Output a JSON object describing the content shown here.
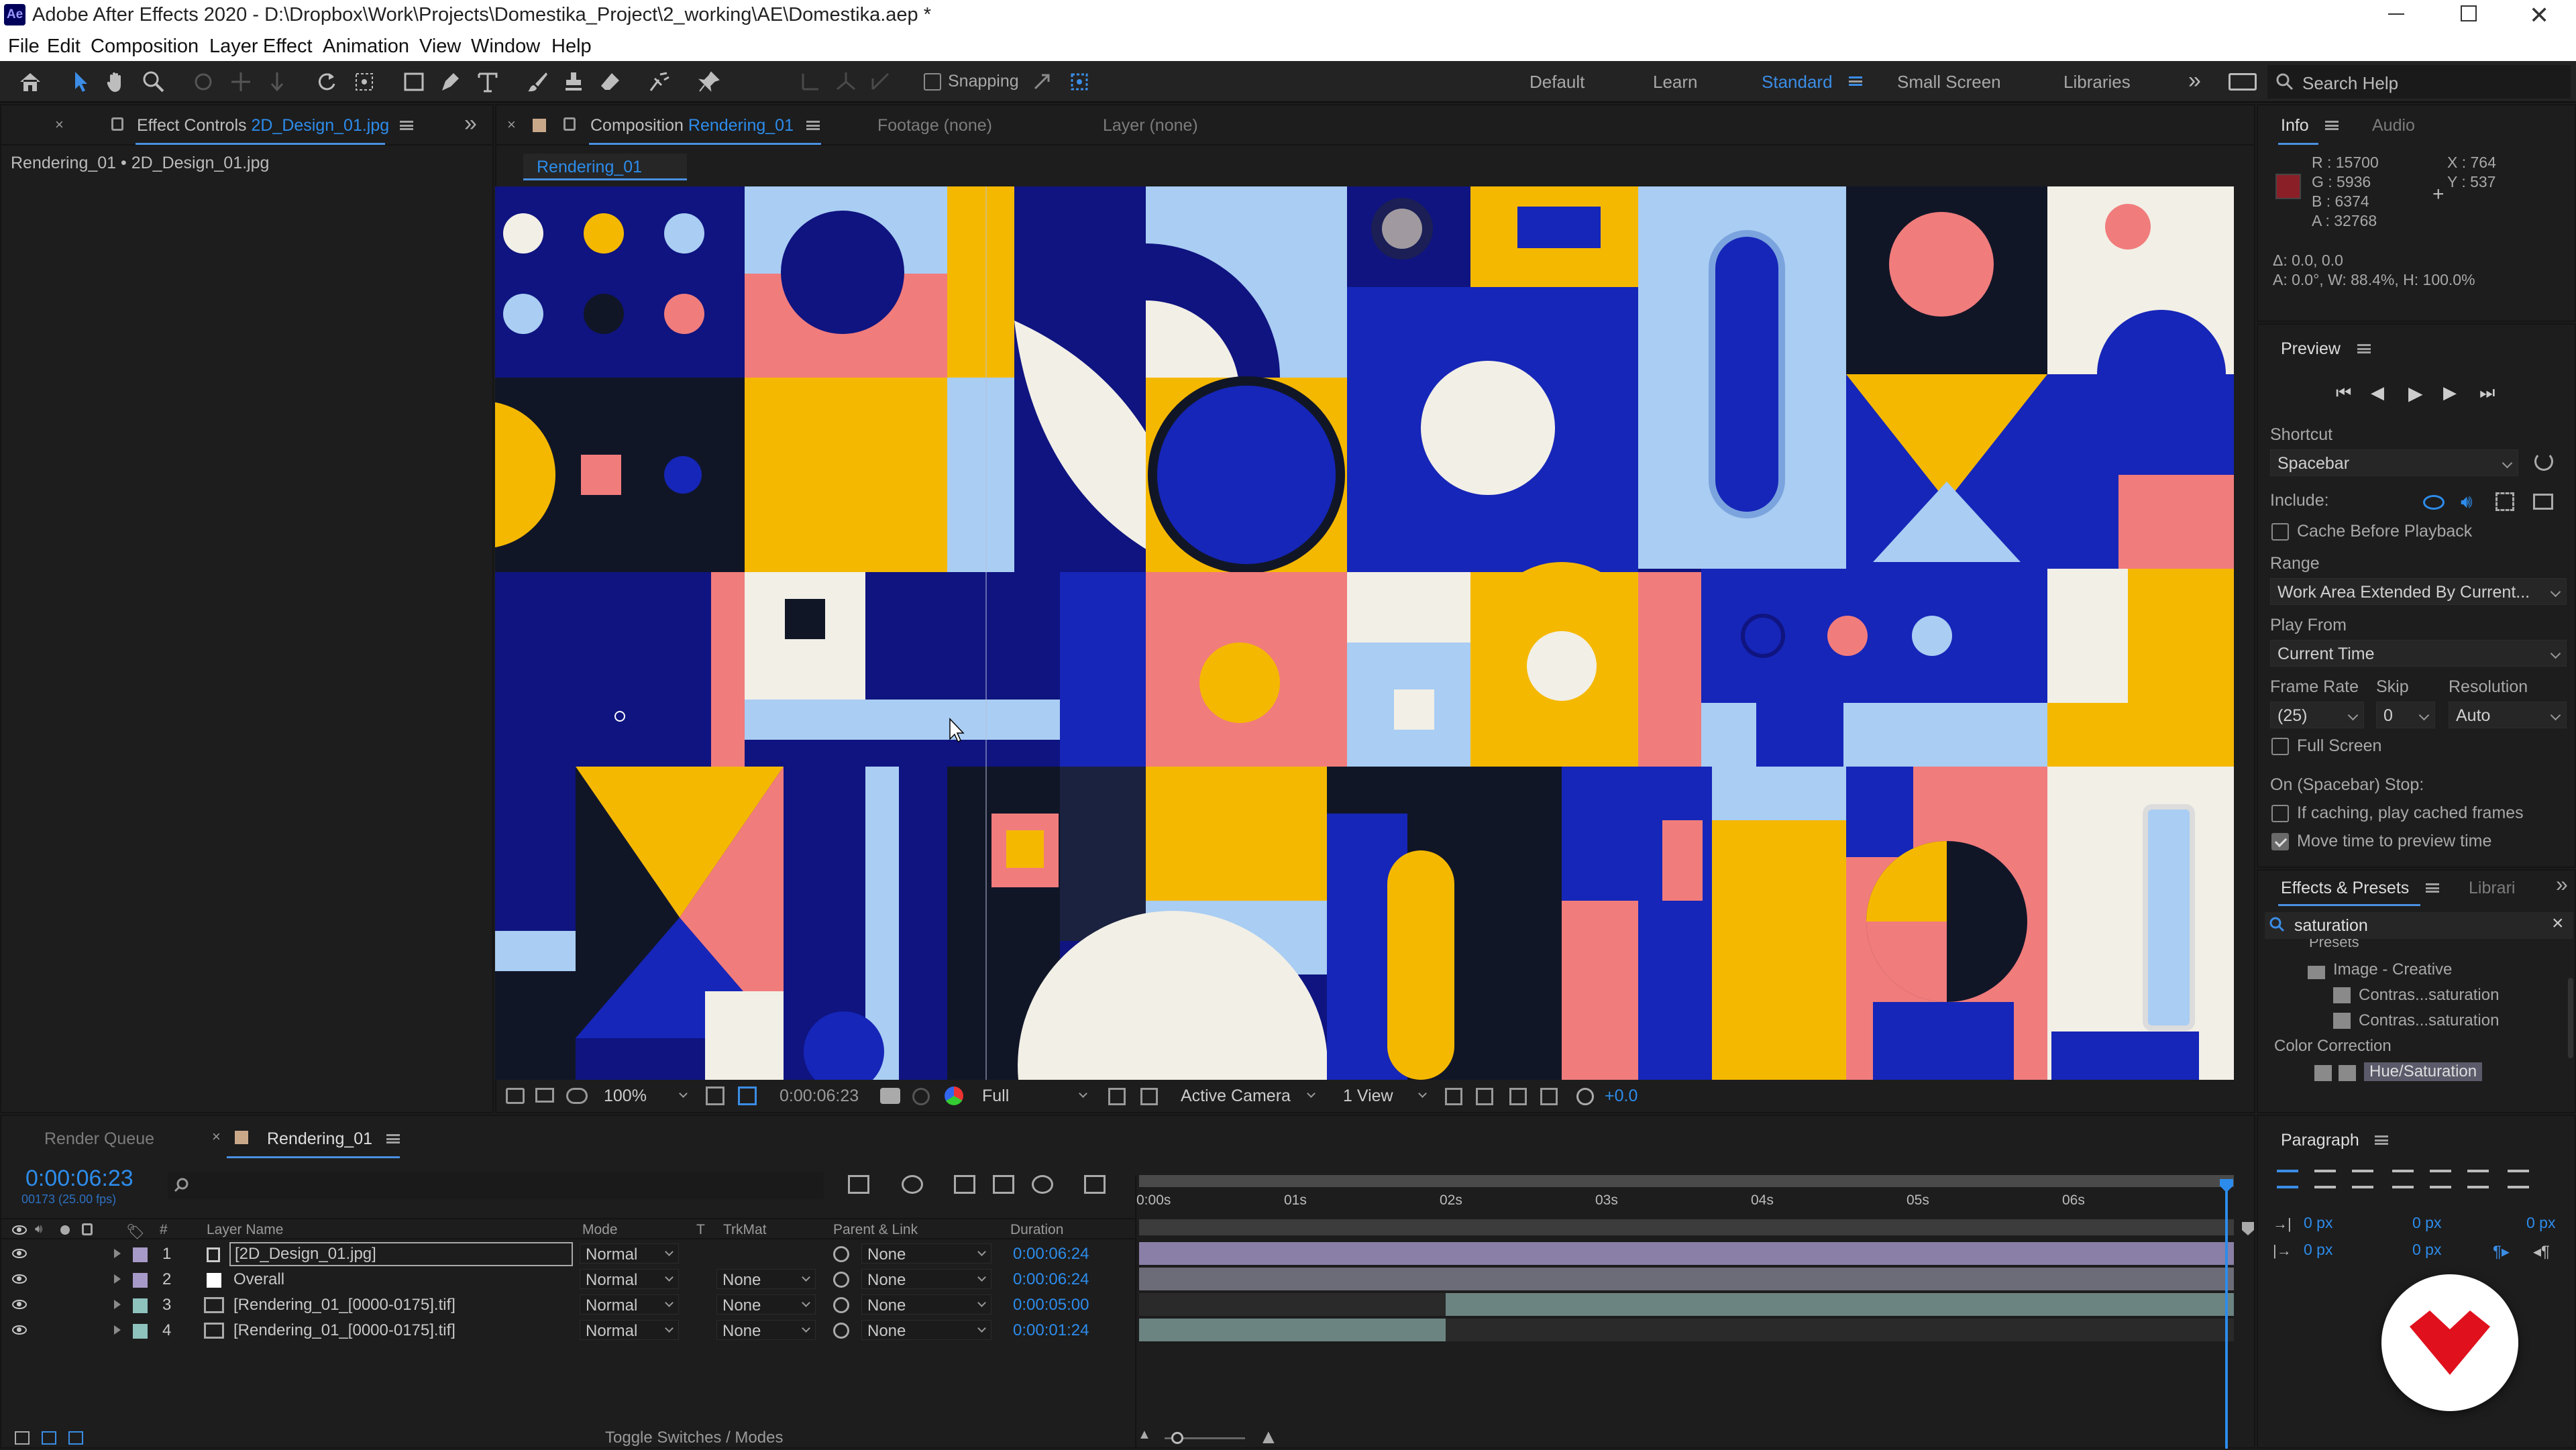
{
  "app": {
    "title": "Adobe After Effects 2020 - D:\\Dropbox\\Work\\Projects\\Domestika_Project\\2_working\\AE\\Domestika.aep *",
    "logo": "Ae"
  },
  "menu": [
    "File",
    "Edit",
    "Composition",
    "Layer",
    "Effect",
    "Animation",
    "View",
    "Window",
    "Help"
  ],
  "toolbar": {
    "snapping_label": "Snapping",
    "search_placeholder": "Search Help"
  },
  "workspaces": [
    "Default",
    "Learn",
    "Standard",
    "Small Screen",
    "Libraries"
  ],
  "workspace_active": "Standard",
  "effect_controls": {
    "tab_label": "Effect Controls",
    "tab_file": "2D_Design_01.jpg",
    "breadcrumb": "Rendering_01 • 2D_Design_01.jpg"
  },
  "composition": {
    "tab_label": "Composition",
    "tab_name": "Rendering_01",
    "footage_tab": "Footage  (none)",
    "layer_tab": "Layer  (none)",
    "sub_tab": "Rendering_01"
  },
  "viewer_footer": {
    "zoom": "100%",
    "timecode": "0:00:06:23",
    "resolution": "Full",
    "camera": "Active Camera",
    "views": "1 View",
    "exposure": "+0.0"
  },
  "info": {
    "tab_info": "Info",
    "tab_audio": "Audio",
    "r": "R : 15700",
    "g": "G : 5936",
    "b": "B : 6374",
    "a": "A : 32768",
    "x": "X : 764",
    "y": "Y : 537",
    "delta": "Δ: 0.0, 0.0",
    "transform": "A: 0.0°, W: 88.4%, H: 100.0%",
    "swatch_color": "#8a1f28"
  },
  "preview": {
    "title": "Preview",
    "shortcut_label": "Shortcut",
    "shortcut_value": "Spacebar",
    "include_label": "Include:",
    "cache_label": "Cache Before Playback",
    "range_label": "Range",
    "range_value": "Work Area Extended By Current...",
    "play_from_label": "Play From",
    "play_from_value": "Current Time",
    "frame_rate_label": "Frame Rate",
    "skip_label": "Skip",
    "resolution_label": "Resolution",
    "frame_rate_value": "(25)",
    "skip_value": "0",
    "resolution_value": "Auto",
    "full_screen_label": "Full Screen",
    "stop_label": "On (Spacebar) Stop:",
    "if_caching_label": "If caching, play cached frames",
    "move_time_label": "Move time to preview time"
  },
  "effects": {
    "tab_label": "Effects & Presets",
    "tab_libraries": "Librari",
    "search_value": "saturation",
    "tree": [
      "Presets",
      "Image - Creative",
      "Contras...saturation",
      "Contras...saturation",
      "Color Correction",
      "Hue/Saturation"
    ]
  },
  "paragraph": {
    "title": "Paragraph",
    "indent_values": [
      "0 px",
      "0 px",
      "0 px",
      "0 px",
      "0 px"
    ]
  },
  "timeline": {
    "render_queue_tab": "Render Queue",
    "comp_tab": "Rendering_01",
    "current_time": "0:00:06:23",
    "frame_info": "00173 (25.00 fps)",
    "columns": [
      "#",
      "Layer Name",
      "Mode",
      "T",
      "TrkMat",
      "Parent & Link",
      "Duration"
    ],
    "ruler": [
      "0:00s",
      "01s",
      "02s",
      "03s",
      "04s",
      "05s",
      "06s"
    ],
    "playhead_fraction": 0.992,
    "layers": [
      {
        "num": "1",
        "name": "[2D_Design_01.jpg]",
        "mode": "Normal",
        "trkmat": "",
        "parent": "None",
        "duration": "0:00:06:24",
        "label_color": "#a89ac8",
        "bar_color": "#8a7fa6",
        "start_fraction": 0.0,
        "end_fraction": 1.0
      },
      {
        "num": "2",
        "name": "Overall",
        "mode": "Normal",
        "trkmat": "None",
        "parent": "None",
        "duration": "0:00:06:24",
        "label_color": "#a89ac8",
        "bar_color": "#6c6c78",
        "start_fraction": 0.0,
        "end_fraction": 1.0
      },
      {
        "num": "3",
        "name": "[Rendering_01_[0000-0175].tif]",
        "mode": "Normal",
        "trkmat": "None",
        "parent": "None",
        "duration": "0:00:05:00",
        "label_color": "#8ec2bd",
        "bar_color": "#6b8481",
        "start_fraction": 0.28,
        "end_fraction": 1.0
      },
      {
        "num": "4",
        "name": "[Rendering_01_[0000-0175].tif]",
        "mode": "Normal",
        "trkmat": "None",
        "parent": "None",
        "duration": "0:00:01:24",
        "label_color": "#8ec2bd",
        "bar_color": "#6b8481",
        "start_fraction": 0.0,
        "end_fraction": 0.28
      }
    ],
    "footer_toggle": "Toggle Switches / Modes"
  },
  "watermark": {
    "brand_color": "#e0101d"
  }
}
